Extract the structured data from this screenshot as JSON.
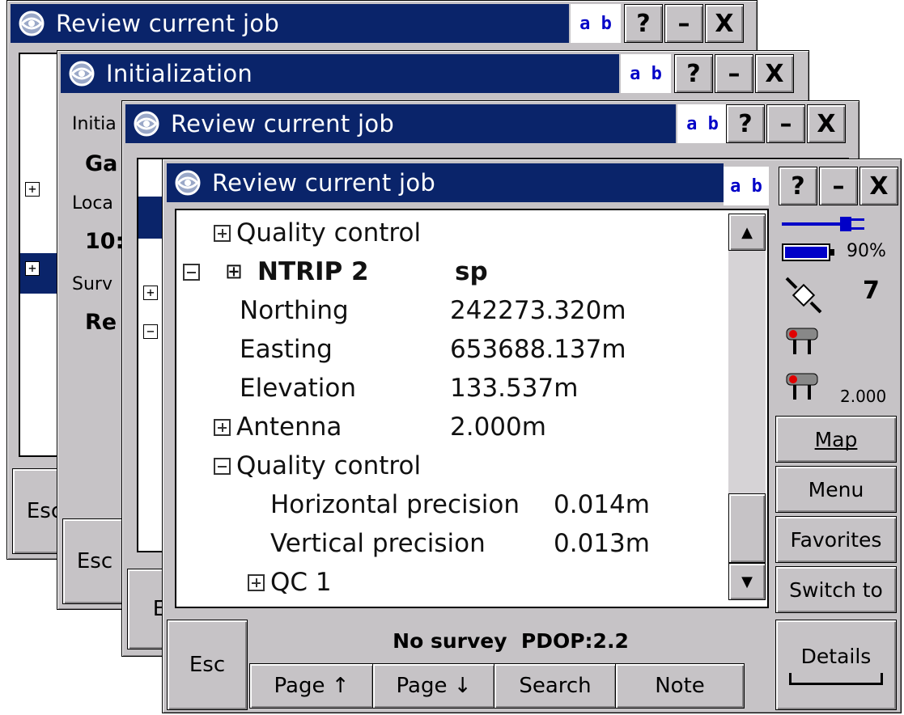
{
  "windows": {
    "back1": {
      "title": "Review current job",
      "ab": "a b",
      "esc": "Esc"
    },
    "back2": {
      "title": "Initialization",
      "ab": "a b",
      "esc": "Esc",
      "lines": [
        "Initia",
        "Ga",
        "Loca",
        "10:",
        "Surv",
        "Re"
      ]
    },
    "back3": {
      "title": "Review current job",
      "ab": "a b",
      "esc": "E"
    },
    "front": {
      "title": "Review current job",
      "ab": "a b"
    }
  },
  "title_buttons": {
    "help": "?",
    "minimize": "–",
    "close": "X"
  },
  "tree": {
    "quality_control_top": "Quality control",
    "point_name": "NTRIP 2",
    "point_code": "sp",
    "northing_label": "Northing",
    "northing_value": "242273.320m",
    "easting_label": "Easting",
    "easting_value": "653688.137m",
    "elevation_label": "Elevation",
    "elevation_value": "133.537m",
    "antenna_label": "Antenna",
    "antenna_value": "2.000m",
    "quality_control": "Quality control",
    "hprec_label": "Horizontal precision",
    "hprec_value": "0.014m",
    "vprec_label": "Vertical precision",
    "vprec_value": "0.013m",
    "qc1": "QC 1"
  },
  "status": {
    "battery": "90%",
    "satellites": "7",
    "antenna_height": "2.000"
  },
  "side_buttons": {
    "map": "Map",
    "menu": "Menu",
    "favorites": "Favorites",
    "switch_to": "Switch to",
    "details": "Details"
  },
  "bottom": {
    "esc": "Esc",
    "status_line": "No survey  PDOP:2.2",
    "page_up": "Page ↑",
    "page_down": "Page ↓",
    "search": "Search",
    "note": "Note"
  }
}
